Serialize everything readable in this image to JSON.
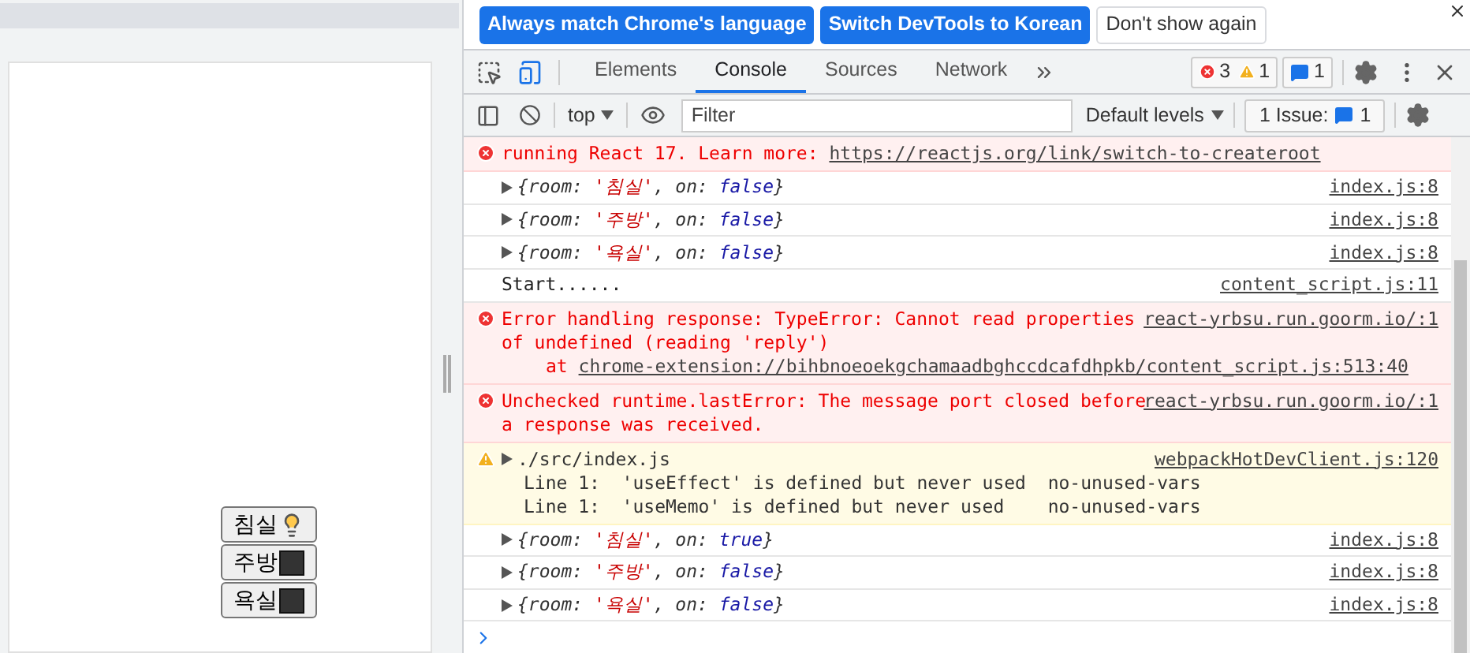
{
  "page": {
    "rooms": [
      {
        "name": "침실",
        "on": true
      },
      {
        "name": "주방",
        "on": false
      },
      {
        "name": "욕실",
        "on": false
      }
    ]
  },
  "infobar": {
    "buttons": [
      {
        "label": "Always match Chrome's language",
        "kind": "primary"
      },
      {
        "label": "Switch DevTools to Korean",
        "kind": "primary"
      },
      {
        "label": "Don't show again",
        "kind": "secondary"
      }
    ]
  },
  "tabs": [
    {
      "label": "Elements",
      "selected": false
    },
    {
      "label": "Console",
      "selected": true
    },
    {
      "label": "Sources",
      "selected": false
    },
    {
      "label": "Network",
      "selected": false
    }
  ],
  "counts": {
    "errors": "3",
    "warnings": "1",
    "messages": "1"
  },
  "toolbar": {
    "context": "top",
    "filter_placeholder": "Filter",
    "levels": "Default levels",
    "issues": "1 Issue:",
    "issues_count": "1"
  },
  "messages": [
    {
      "kind": "error",
      "lines": [
        "running React 17. Learn more: "
      ],
      "link": "https://reactjs.org/link/switch-to-createroot"
    },
    {
      "kind": "object",
      "segments": [
        {
          "text": "{room: ",
          "kind": "key"
        },
        {
          "text": "'침실'",
          "kind": "string"
        },
        {
          "text": ", on: ",
          "kind": "key"
        },
        {
          "text": "false",
          "kind": "bool"
        },
        {
          "text": "}",
          "kind": "key"
        }
      ],
      "source": "index.js:8"
    },
    {
      "kind": "object",
      "segments": [
        {
          "text": "{room: ",
          "kind": "key"
        },
        {
          "text": "'주방'",
          "kind": "string"
        },
        {
          "text": ", on: ",
          "kind": "key"
        },
        {
          "text": "false",
          "kind": "bool"
        },
        {
          "text": "}",
          "kind": "key"
        }
      ],
      "source": "index.js:8"
    },
    {
      "kind": "object",
      "segments": [
        {
          "text": "{room: ",
          "kind": "key"
        },
        {
          "text": "'욕실'",
          "kind": "string"
        },
        {
          "text": ", on: ",
          "kind": "key"
        },
        {
          "text": "false",
          "kind": "bool"
        },
        {
          "text": "}",
          "kind": "key"
        }
      ],
      "source": "index.js:8"
    },
    {
      "kind": "log",
      "lines": [
        "Start......"
      ],
      "source": "content_script.js:11"
    },
    {
      "kind": "error",
      "lines": [
        "Error handling response: TypeError: Cannot read properties",
        "of undefined (reading 'reply')"
      ],
      "at": "at ",
      "link": "chrome-extension://bihbnoeoekgchamaadbghccdcafdhpkb/content_script.js:513:40",
      "source": "react-yrbsu.run.goorm.io/:1"
    },
    {
      "kind": "error",
      "lines": [
        "Unchecked runtime.lastError: The message port closed before",
        "a response was received."
      ],
      "source": "react-yrbsu.run.goorm.io/:1"
    },
    {
      "kind": "warning",
      "lines": [
        "./src/index.js",
        "Line 1:  'useEffect' is defined but never used  no-unused-vars",
        "Line 1:  'useMemo' is defined but never used    no-unused-vars"
      ],
      "source": "webpackHotDevClient.js:120"
    },
    {
      "kind": "object",
      "segments": [
        {
          "text": "{room: ",
          "kind": "key"
        },
        {
          "text": "'침실'",
          "kind": "string"
        },
        {
          "text": ", on: ",
          "kind": "key"
        },
        {
          "text": "true",
          "kind": "bool"
        },
        {
          "text": "}",
          "kind": "key"
        }
      ],
      "source": "index.js:8"
    },
    {
      "kind": "object",
      "segments": [
        {
          "text": "{room: ",
          "kind": "key"
        },
        {
          "text": "'주방'",
          "kind": "string"
        },
        {
          "text": ", on: ",
          "kind": "key"
        },
        {
          "text": "false",
          "kind": "bool"
        },
        {
          "text": "}",
          "kind": "key"
        }
      ],
      "source": "index.js:8"
    },
    {
      "kind": "object",
      "segments": [
        {
          "text": "{room: ",
          "kind": "key"
        },
        {
          "text": "'욕실'",
          "kind": "string"
        },
        {
          "text": ", on: ",
          "kind": "key"
        },
        {
          "text": "false",
          "kind": "bool"
        },
        {
          "text": "}",
          "kind": "key"
        }
      ],
      "source": "index.js:8"
    }
  ]
}
